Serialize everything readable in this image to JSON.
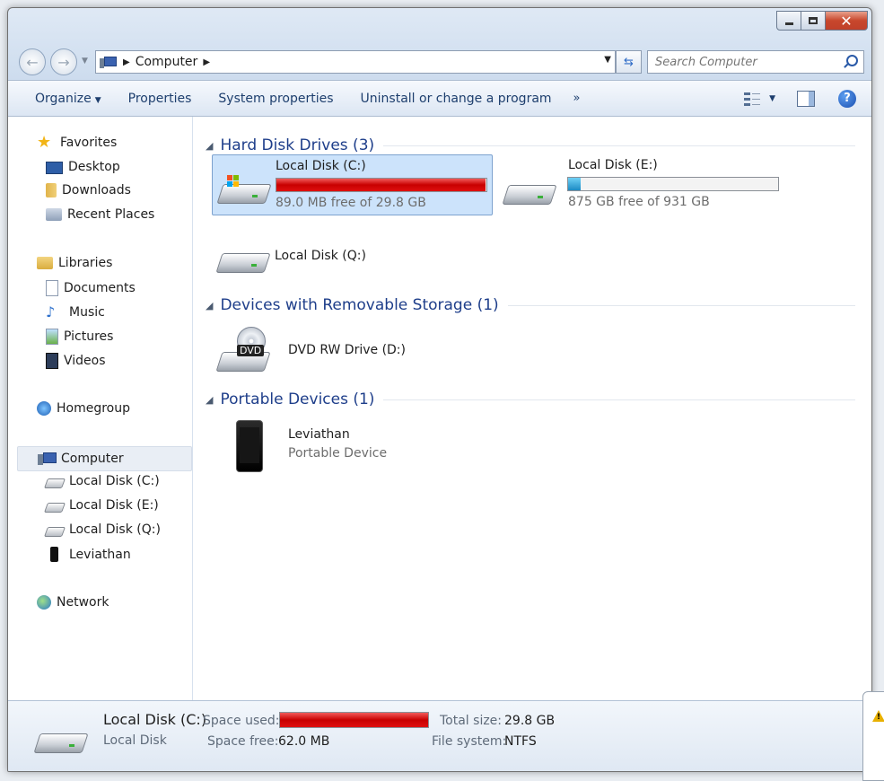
{
  "window": {
    "caption": {
      "minimize_icon": "minimize-icon",
      "maximize_icon": "maximize-icon",
      "close_icon": "close-icon"
    }
  },
  "address": {
    "back_icon": "back-arrow-icon",
    "forward_icon": "forward-arrow-icon",
    "crumb": "Computer",
    "search_placeholder": "Search Computer"
  },
  "toolbar": {
    "organize": "Organize",
    "properties": "Properties",
    "system_properties": "System properties",
    "uninstall": "Uninstall or change a program",
    "more": "»"
  },
  "nav": {
    "favorites": "Favorites",
    "desktop": "Desktop",
    "downloads": "Downloads",
    "recent_places": "Recent Places",
    "libraries": "Libraries",
    "documents": "Documents",
    "music": "Music",
    "pictures": "Pictures",
    "videos": "Videos",
    "homegroup": "Homegroup",
    "computer": "Computer",
    "disk_c": "Local Disk (C:)",
    "disk_e": "Local Disk (E:)",
    "disk_q": "Local Disk (Q:)",
    "leviathan": "Leviathan",
    "network": "Network"
  },
  "groups": {
    "hard_disks": "Hard Disk Drives (3)",
    "removable": "Devices with Removable Storage (1)",
    "portable": "Portable Devices (1)"
  },
  "drives": {
    "c": {
      "name": "Local Disk (C:)",
      "free": "89.0 MB free of 29.8 GB",
      "used_fraction": 0.997,
      "bar_color": "#d40000"
    },
    "e": {
      "name": "Local Disk (E:)",
      "free": "875 GB free of 931 GB",
      "used_fraction": 0.06,
      "bar_color": "#2b9fd6"
    },
    "q": {
      "name": "Local Disk (Q:)"
    },
    "dvd": {
      "name": "DVD RW Drive (D:)",
      "badge": "DVD"
    },
    "phone": {
      "name": "Leviathan",
      "type": "Portable Device"
    }
  },
  "details": {
    "name": "Local Disk (C:)",
    "type": "Local Disk",
    "space_used_label": "Space used:",
    "space_free_label": "Space free:",
    "space_free": "62.0 MB",
    "total_size_label": "Total size:",
    "total_size": "29.8 GB",
    "file_system_label": "File system:",
    "file_system": "NTFS",
    "used_fraction": 0.998
  },
  "colors": {
    "accent": "#1e3e8a",
    "selection": "#cce3fb",
    "warning_bar": "#d40000",
    "normal_bar": "#2b9fd6"
  },
  "peek_window": {
    "icon": "warning-icon"
  }
}
